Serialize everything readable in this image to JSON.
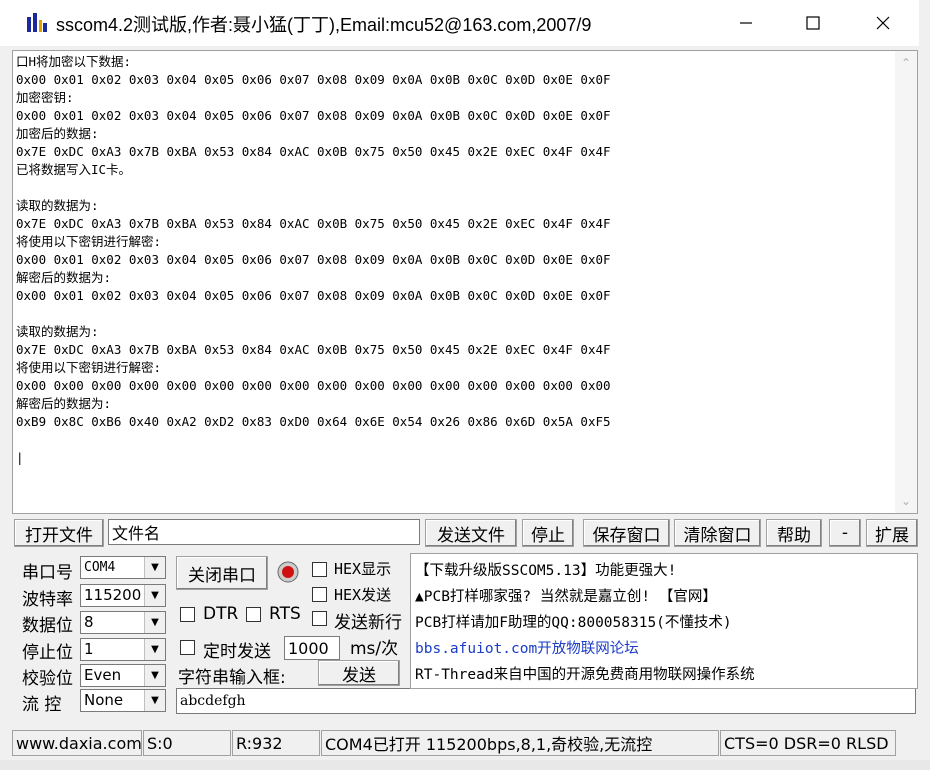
{
  "window": {
    "title": "sscom4.2测试版,作者:聂小猛(丁丁),Email:mcu52@163.com,2007/9"
  },
  "receive_lines": [
    "口H将加密以下数据:",
    "0x00 0x01 0x02 0x03 0x04 0x05 0x06 0x07 0x08 0x09 0x0A 0x0B 0x0C 0x0D 0x0E 0x0F",
    "加密密钥:",
    "0x00 0x01 0x02 0x03 0x04 0x05 0x06 0x07 0x08 0x09 0x0A 0x0B 0x0C 0x0D 0x0E 0x0F",
    "加密后的数据:",
    "0x7E 0xDC 0xA3 0x7B 0xBA 0x53 0x84 0xAC 0x0B 0x75 0x50 0x45 0x2E 0xEC 0x4F 0x4F",
    "已将数据写入IC卡。",
    "",
    "读取的数据为:",
    "0x7E 0xDC 0xA3 0x7B 0xBA 0x53 0x84 0xAC 0x0B 0x75 0x50 0x45 0x2E 0xEC 0x4F 0x4F",
    "将使用以下密钥进行解密:",
    "0x00 0x01 0x02 0x03 0x04 0x05 0x06 0x07 0x08 0x09 0x0A 0x0B 0x0C 0x0D 0x0E 0x0F",
    "解密后的数据为:",
    "0x00 0x01 0x02 0x03 0x04 0x05 0x06 0x07 0x08 0x09 0x0A 0x0B 0x0C 0x0D 0x0E 0x0F",
    "",
    "读取的数据为:",
    "0x7E 0xDC 0xA3 0x7B 0xBA 0x53 0x84 0xAC 0x0B 0x75 0x50 0x45 0x2E 0xEC 0x4F 0x4F",
    "将使用以下密钥进行解密:",
    "0x00 0x00 0x00 0x00 0x00 0x00 0x00 0x00 0x00 0x00 0x00 0x00 0x00 0x00 0x00 0x00",
    "解密后的数据为:",
    "0xB9 0x8C 0xB6 0x40 0xA2 0xD2 0x83 0xD0 0x64 0x6E 0x54 0x26 0x86 0x6D 0x5A 0xF5",
    "",
    "|"
  ],
  "toolbar": {
    "open_file": "打开文件",
    "filename": "文件名",
    "send_file": "发送文件",
    "stop": "停止",
    "save_window": "保存窗口",
    "clear_window": "清除窗口",
    "help": "帮助",
    "minus": "-",
    "expand": "扩展"
  },
  "settings": {
    "port_label": "串口号",
    "port_value": "COM4",
    "baud_label": "波特率",
    "baud_value": "115200",
    "databits_label": "数据位",
    "databits_value": "8",
    "stopbits_label": "停止位",
    "stopbits_value": "1",
    "parity_label": "校验位",
    "parity_value": "Even",
    "flow_label": "流 控",
    "flow_value": "None"
  },
  "controls": {
    "close_port": "关闭串口",
    "hex_display": "HEX显示",
    "hex_send": "HEX发送",
    "send_newline": "发送新行",
    "dtr": "DTR",
    "rts": "RTS",
    "timed_send": "定时发送",
    "interval": "1000",
    "interval_unit": "ms/次",
    "string_input_label": "字符串输入框:",
    "send": "发送",
    "input_value": "abcdefgh"
  },
  "info": {
    "line1": "【下载升级版SSCOM5.13】功能更强大!",
    "line2": "▲PCB打样哪家强? 当然就是嘉立创! 【官网】",
    "line3": "PCB打样请加F助理的QQ:800058315(不懂技术)",
    "line4": "bbs.afuiot.com开放物联网论坛",
    "line5": "RT-Thread来自中国的开源免费商用物联网操作系统"
  },
  "status": {
    "site": "www.daxia.com",
    "sent": "S:0",
    "received": "R:932",
    "port_state": "COM4已打开  115200bps,8,1,奇校验,无流控",
    "lines": "CTS=0 DSR=0 RLSD"
  },
  "colors": {
    "link": "#1a3cc8",
    "record_red": "#d01010"
  }
}
